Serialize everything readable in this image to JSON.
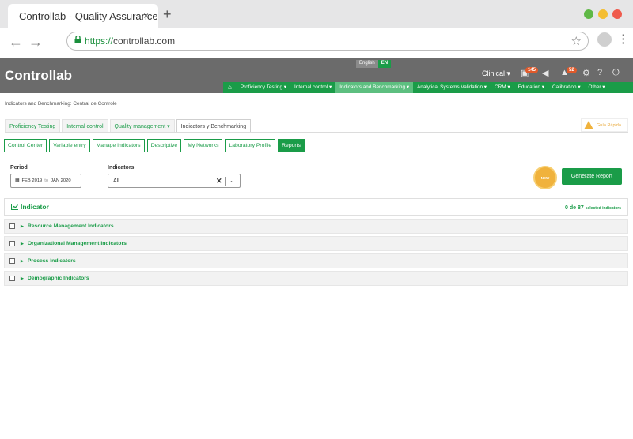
{
  "browser": {
    "tab_title": "Controllab - Quality Assurance",
    "tab_close": "×",
    "new_tab": "+",
    "url_scheme": "https://",
    "url_host": "controllab.com",
    "traffic_colors": [
      "#5fb846",
      "#f4be32",
      "#ef5b4d"
    ]
  },
  "header": {
    "logo": "Controllab",
    "language_name": "English",
    "language_code": "EN",
    "module": "Clinical",
    "badge_messages": "145",
    "badge_alerts": "52"
  },
  "nav": {
    "items": [
      "Proficiency Testing",
      "Internal control",
      "Indicators and Benchmarking",
      "Analytical Systems Validation",
      "CRM",
      "Education",
      "Calibration",
      "Other"
    ],
    "active_index": 2
  },
  "page": {
    "breadcrumb": "Indicators and Benchmarking: Central de Controle",
    "tabs": [
      "Proficiency Testing",
      "Internal control",
      "Quality management",
      "Indicators y Benchmarking"
    ],
    "selected_tab": "Indicators y Benchmarking",
    "guide_label": "Guía Rápida",
    "sub_tabs": [
      "Control Center",
      "Variable entry",
      "Manage Indicators",
      "Descriptive",
      "My Networks",
      "Laboratory Profile",
      "Reports"
    ],
    "active_sub_tab": "Reports",
    "period_label": "Period",
    "period_from": "FEB 2019",
    "period_to_word": "to",
    "period_to": "JAN 2020",
    "indicators_label": "Indicators",
    "indicators_value": "All",
    "new_seal": "NEW",
    "generate_button": "Generate Report",
    "panel_title": "Indicator",
    "selected_count": "0 de 87",
    "selected_suffix": "selected indicators",
    "groups": [
      "Resource Management Indicators",
      "Organizational Management Indicators",
      "Process Indicators",
      "Demographic Indicators"
    ]
  }
}
